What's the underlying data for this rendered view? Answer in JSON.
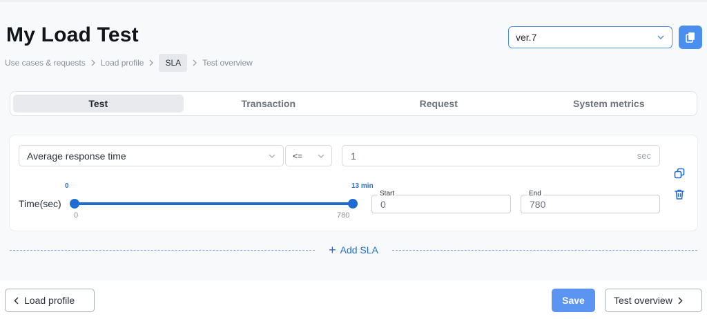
{
  "header": {
    "title": "My Load Test",
    "version": "ver.7",
    "copy_icon": "copy-icon"
  },
  "breadcrumb": [
    {
      "label": "Use cases & requests",
      "active": false
    },
    {
      "label": "Load profile",
      "active": false
    },
    {
      "label": "SLA",
      "active": true
    },
    {
      "label": "Test overview",
      "active": false
    }
  ],
  "tabs": [
    {
      "label": "Test",
      "active": true
    },
    {
      "label": "Transaction",
      "active": false
    },
    {
      "label": "Request",
      "active": false
    },
    {
      "label": "System metrics",
      "active": false
    }
  ],
  "sla": {
    "metric": "Average response time",
    "operator": "<=",
    "value": "1",
    "unit": "sec",
    "time_label": "Time(sec)",
    "range_min_top": "0",
    "range_max_top": "13 min",
    "range_min_bottom": "0",
    "range_max_bottom": "780",
    "start_label": "Start",
    "start_value": "0",
    "end_label": "End",
    "end_value": "780",
    "duplicate_icon": "duplicate-icon",
    "delete_icon": "trash-icon"
  },
  "add_sla_label": "Add SLA",
  "footer": {
    "back_label": "Load profile",
    "save_label": "Save",
    "next_label": "Test overview"
  },
  "colors": {
    "accent": "#1e6cd3",
    "save_button": "#5c94f2"
  }
}
